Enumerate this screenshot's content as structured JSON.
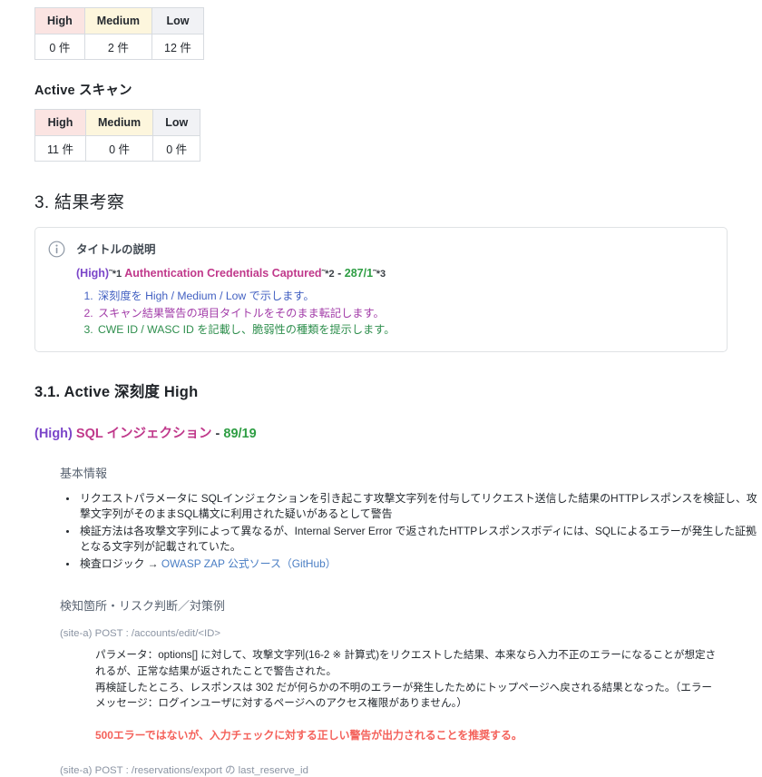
{
  "tables": {
    "passive": {
      "headers": [
        "High",
        "Medium",
        "Low"
      ],
      "values": [
        "0 件",
        "2 件",
        "12 件"
      ]
    },
    "active": {
      "caption": "Active スキャン",
      "headers": [
        "High",
        "Medium",
        "Low"
      ],
      "values": [
        "11 件",
        "0 件",
        "0 件"
      ]
    }
  },
  "section3": {
    "heading": "3. 結果考察",
    "callout": {
      "icon": "info-icon",
      "title": "タイトルの説明",
      "example": {
        "severity": "(High)",
        "marker1": "˜*1",
        "name": "Authentication Credentials Captured",
        "marker2": "˜*2",
        "separator": "-",
        "ids": "287/1",
        "marker3": "˜*3"
      },
      "list": [
        "深刻度を High / Medium / Low で示します。",
        "スキャン結果警告の項目タイトルをそのまま転記します。",
        "CWE ID / WASC ID を記載し、脆弱性の種類を提示します。"
      ]
    }
  },
  "section31": {
    "heading": "3.1. Active 深刻度 High",
    "vuln": {
      "severity": "(High)",
      "name": "SQL インジェクション",
      "separator": "-",
      "ids": "89/19"
    },
    "basic_info": {
      "heading": "基本情報",
      "items": [
        "リクエストパラメータに SQLインジェクションを引き起こす攻撃文字列を付与してリクエスト送信した結果のHTTPレスポンスを検証し、攻撃文字列がそのままSQL構文に利用された疑いがあるとして警告",
        "検証方法は各攻撃文字列によって異なるが、Internal Server Error で返されたHTTPレスポンスボディには、SQLによるエラーが発生した証拠となる文字列が記載されていた。",
        "検査ロジック →"
      ],
      "link_text": "OWASP ZAP 公式ソース（GitHub）"
    },
    "detection": {
      "heading": "検知箇所・リスク判断／対策例",
      "entries": [
        {
          "endpoint": "(site-a) POST : /accounts/edit/<ID>",
          "detail": "パラメータ：options[] に対して、攻撃文字列(16-2 ※ 計算式)をリクエストした結果、本来なら入力不正のエラーになることが想定されるが、正常な結果が返されたことで警告された。\n再検証したところ、レスポンスは 302 だが何らかの不明のエラーが発生したためにトップページへ戻される結果となった。（エラーメッセージ：ログインユーザに対するページへのアクセス権限がありません。）",
          "warning": "500エラーではないが、入力チェックに対する正しい警告が出力されることを推奨する。"
        },
        {
          "endpoint": "(site-a) POST : /reservations/export の last_reserve_id"
        }
      ]
    }
  },
  "colors": {
    "severity_high": "#7b46c9",
    "title_magenta": "#c0398b",
    "id_green": "#2f9e44",
    "warning_red": "#f4615a",
    "link_blue": "#4a7ec4",
    "th_high_bg": "#fbe4e2",
    "th_medium_bg": "#fdf6dd",
    "th_low_bg": "#f1f2f5"
  }
}
